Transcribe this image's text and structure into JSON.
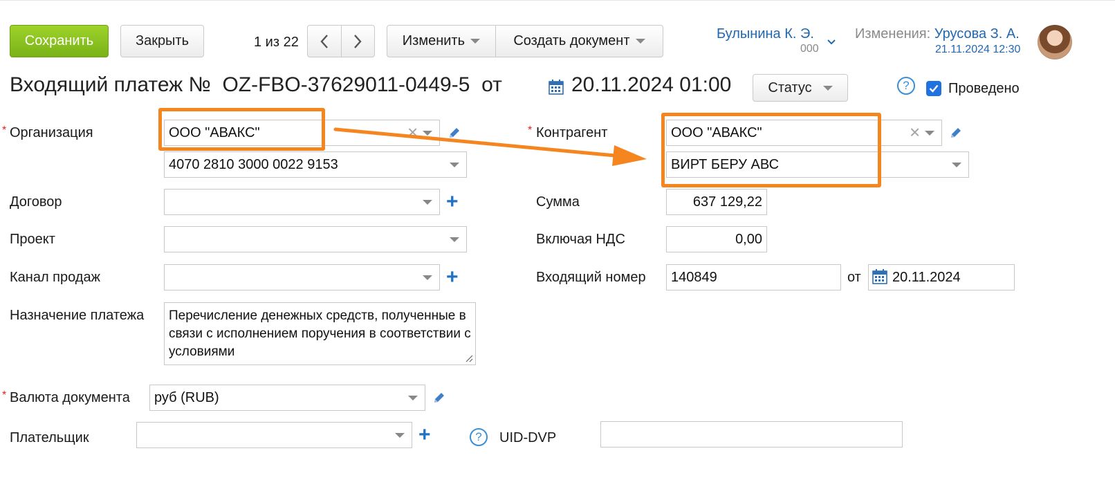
{
  "toolbar": {
    "save_label": "Сохранить",
    "close_label": "Закрыть",
    "pager_text": "1 из 22",
    "change_label": "Изменить",
    "create_doc_label": "Создать документ"
  },
  "user": {
    "name": "Булынина К. Э.",
    "code": "000",
    "changes_label": "Изменения:",
    "changes_user": "Урусова З. А.",
    "changes_date": "21.11.2024 12:30"
  },
  "doc": {
    "title_prefix": "Входящий платеж №",
    "number": "OZ-FBO-37629011-0449-5",
    "from_label": "от",
    "datetime": "20.11.2024 01:00",
    "status_label": "Статус",
    "posted_label": "Проведено"
  },
  "left": {
    "org_label": "Организация",
    "org_value": "ООО \"АВАКС\"",
    "account_value": "4070 2810 3000 0022 9153",
    "contract_label": "Договор",
    "contract_value": "",
    "project_label": "Проект",
    "project_value": "",
    "channel_label": "Канал продаж",
    "channel_value": "",
    "purpose_label": "Назначение платежа",
    "purpose_value": "Перечисление денежных средств, полученные в связи с исполнением поручения в соответствии с условиями"
  },
  "right": {
    "counterparty_label": "Контрагент",
    "counterparty_value": "ООО \"АВАКС\"",
    "counterparty_account_value": "ВИРТ БЕРУ АВС",
    "sum_label": "Сумма",
    "sum_value": "637 129,22",
    "vat_label": "Включая НДС",
    "vat_value": "0,00",
    "incoming_label": "Входящий номер",
    "incoming_value": "140849",
    "incoming_from_label": "от",
    "incoming_date": "20.11.2024"
  },
  "bottom": {
    "currency_label": "Валюта документа",
    "currency_value": "руб (RUB)",
    "payer_label": "Плательщик",
    "payer_value": "",
    "uid_label": "UID-DVP",
    "uid_value": ""
  },
  "required_mark": "*",
  "colors": {
    "highlight": "#f5861f",
    "link": "#2068b3",
    "save_button": "#86c11f",
    "checkbox": "#1f72e0"
  },
  "icons": [
    "chevron-left-icon",
    "chevron-right-icon",
    "calendar-icon",
    "pencil-icon",
    "plus-icon",
    "help-icon",
    "check-icon",
    "clear-icon",
    "dropdown-arrow-icon",
    "arrow-annotation"
  ]
}
